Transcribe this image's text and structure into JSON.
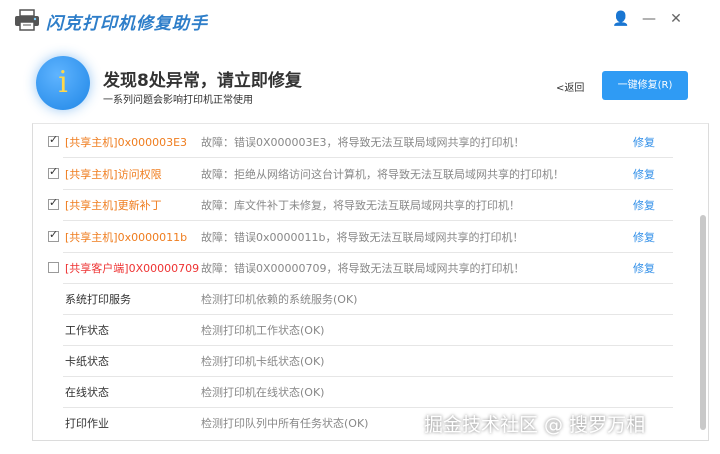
{
  "app": {
    "title": "闪克打印机修复助手"
  },
  "window_controls": {
    "user": "👤",
    "minimize": "—",
    "close": "✕"
  },
  "header": {
    "icon_glyph": "i",
    "headline": "发现8处异常，请立即修复",
    "subline": "一系列问题会影响打印机正常使用",
    "back_label": "<返回",
    "fix_all_label": "一键修复(R)"
  },
  "colors": {
    "accent": "#2f9bf4",
    "warning": "#ef7d1f",
    "error": "#e33333",
    "link": "#2f8ee8"
  },
  "issues": [
    {
      "checked": true,
      "name": "[共享主机]0x000003E3",
      "desc": "故障：错误0X000003E3，将导致无法互联局域网共享的打印机！",
      "fix": "修复",
      "severity": "warning"
    },
    {
      "checked": true,
      "name": "[共享主机]访问权限",
      "desc": "故障：拒绝从网络访问这台计算机，将导致无法互联局域网共享的打印机！",
      "fix": "修复",
      "severity": "warning"
    },
    {
      "checked": true,
      "name": "[共享主机]更新补丁",
      "desc": "故障：库文件补丁未修复，将导致无法互联局域网共享的打印机！",
      "fix": "修复",
      "severity": "warning"
    },
    {
      "checked": true,
      "name": "[共享主机]0x0000011b",
      "desc": "故障：错误0x0000011b，将导致无法互联局域网共享的打印机！",
      "fix": "修复",
      "severity": "warning"
    },
    {
      "checked": false,
      "name": "[共享客户端]0X00000709",
      "desc": "故障：错误0X00000709，将导致无法互联局域网共享的打印机！",
      "fix": "修复",
      "severity": "error"
    }
  ],
  "checks": [
    {
      "name": "系统打印服务",
      "desc": "检测打印机依赖的系统服务(OK)"
    },
    {
      "name": "工作状态",
      "desc": "检测打印机工作状态(OK)"
    },
    {
      "name": "卡纸状态",
      "desc": "检测打印机卡纸状态(OK)"
    },
    {
      "name": "在线状态",
      "desc": "检测打印机在线状态(OK)"
    },
    {
      "name": "打印作业",
      "desc": "检测打印队列中所有任务状态(OK)"
    }
  ],
  "watermark": "掘金技术社区 @ 搜罗万相"
}
